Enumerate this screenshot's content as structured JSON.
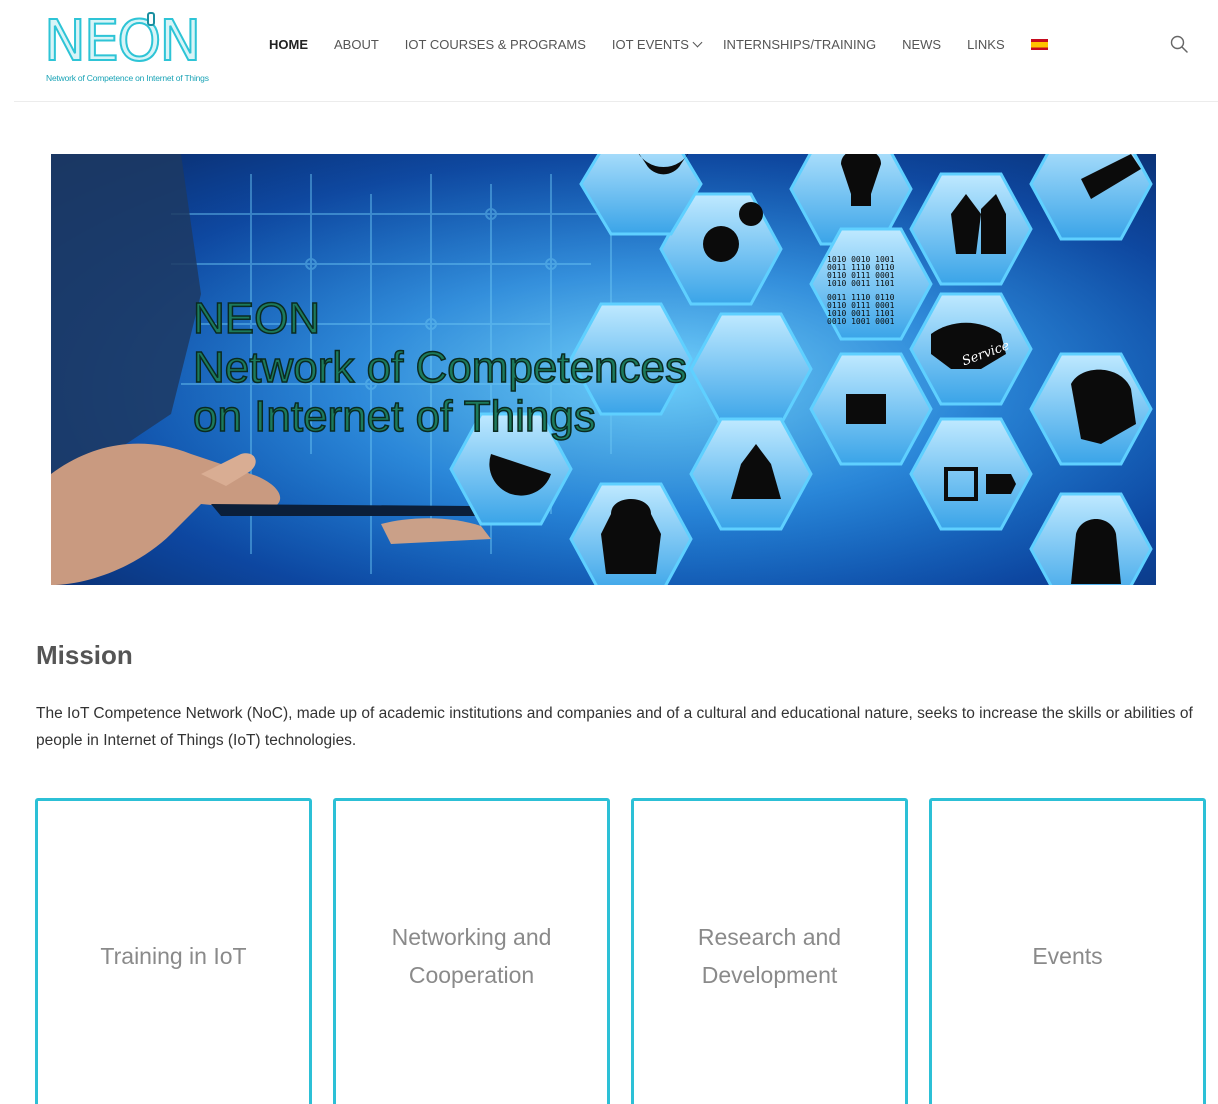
{
  "header": {
    "logo": {
      "wordmark": "NEON",
      "tagline": "Network of Competence on Internet of Things"
    },
    "nav": [
      {
        "label": "HOME",
        "active": true,
        "has_dropdown": false
      },
      {
        "label": "ABOUT",
        "active": false,
        "has_dropdown": false
      },
      {
        "label": "IOT COURSES & PROGRAMS",
        "active": false,
        "has_dropdown": false
      },
      {
        "label": "IOT EVENTS",
        "active": false,
        "has_dropdown": true
      },
      {
        "label": "INTERNSHIPS/TRAINING",
        "active": false,
        "has_dropdown": false
      },
      {
        "label": "NEWS",
        "active": false,
        "has_dropdown": false
      },
      {
        "label": "LINKS",
        "active": false,
        "has_dropdown": false
      }
    ],
    "language_flag": "spain-flag-icon",
    "search_icon": "search-icon"
  },
  "hero": {
    "line1": "NEON",
    "line2": "Network of Competences",
    "line3": "on Internet of Things",
    "binary": [
      "1010 0010 1001",
      "0011 1110 0110",
      "0110 0111 0001",
      "1010 0011 1101",
      "0011 1110 0110",
      "0110 0111 0001",
      "1010 0011 1101",
      "0010 1001 0001"
    ],
    "service_label": "Service"
  },
  "mission": {
    "title": "Mission",
    "text": "The IoT Competence Network (NoC), made up of academic institutions and companies and of a cultural and educational nature, seeks to increase the skills or abilities of people in Internet of Things (IoT) technologies."
  },
  "cards": [
    {
      "label": "Training in IoT"
    },
    {
      "label": "Networking and Cooperation"
    },
    {
      "label": "Research and Development"
    },
    {
      "label": "Events"
    }
  ],
  "colors": {
    "accent": "#2cc0d6",
    "logo": "#2ec4d6",
    "hero_title": "#1c7a5c"
  }
}
